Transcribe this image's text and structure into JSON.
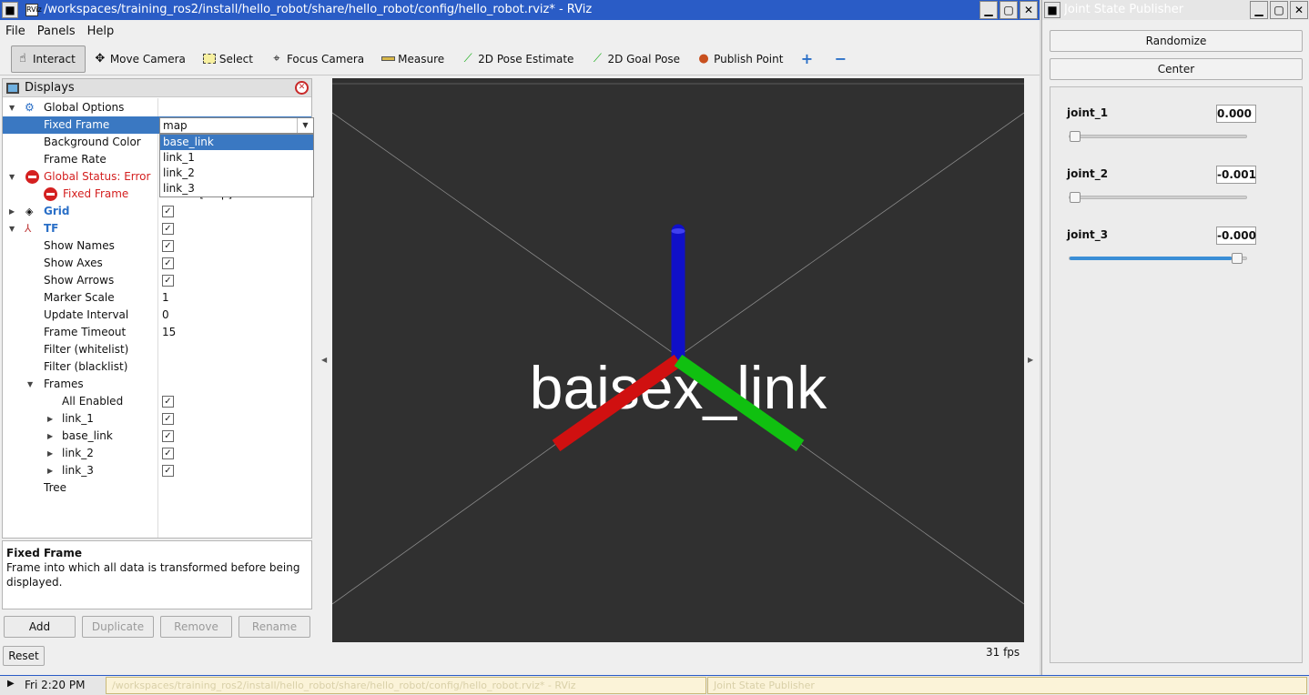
{
  "rviz": {
    "title": "/workspaces/training_ros2/install/hello_robot/share/hello_robot/config/hello_robot.rviz* - RViz",
    "app_icon": "RViz",
    "menus": [
      "File",
      "Panels",
      "Help"
    ],
    "tools": {
      "interact": "Interact",
      "move_camera": "Move Camera",
      "select": "Select",
      "focus_camera": "Focus Camera",
      "measure": "Measure",
      "pose_estimate": "2D Pose Estimate",
      "goal_pose": "2D Goal Pose",
      "publish_point": "Publish Point"
    },
    "displays": {
      "title": "Displays",
      "rows": {
        "global_options": "Global Options",
        "fixed_frame": "Fixed Frame",
        "fixed_frame_value": "map",
        "background_color": "Background Color",
        "frame_rate": "Frame Rate",
        "global_status": "Global Status: Error",
        "status_fixed_frame": "Fixed Frame",
        "status_fixed_frame_msg": "Frame [map] does not exist",
        "grid": "Grid",
        "tf": "TF",
        "show_names": "Show Names",
        "show_axes": "Show Axes",
        "show_arrows": "Show Arrows",
        "marker_scale": "Marker Scale",
        "marker_scale_value": "1",
        "update_interval": "Update Interval",
        "update_interval_value": "0",
        "frame_timeout": "Frame Timeout",
        "frame_timeout_value": "15",
        "filter_whitelist": "Filter (whitelist)",
        "filter_blacklist": "Filter (blacklist)",
        "frames": "Frames",
        "all_enabled": "All Enabled",
        "link_1": "link_1",
        "base_link": "base_link",
        "link_2": "link_2",
        "link_3": "link_3",
        "tree": "Tree"
      },
      "dropdown_options": [
        "base_link",
        "link_1",
        "link_2",
        "link_3"
      ]
    },
    "description": {
      "title": "Fixed Frame",
      "text": "Frame into which all data is transformed before being displayed."
    },
    "buttons": {
      "add": "Add",
      "duplicate": "Duplicate",
      "remove": "Remove",
      "rename": "Rename",
      "reset": "Reset"
    },
    "view": {
      "overlay_text": "baisex_link",
      "fps": "31 fps"
    },
    "colors": {
      "x_axis": "#d01010",
      "y_axis": "#10c010",
      "z_axis": "#1010c8",
      "view_bg": "#303030",
      "selection": "#3a78c2"
    }
  },
  "jsp": {
    "title": "Joint State Publisher",
    "randomize": "Randomize",
    "center": "Center",
    "joints": [
      {
        "name": "joint_1",
        "value": "0.000",
        "level": 0.0
      },
      {
        "name": "joint_2",
        "value": "-0.001",
        "level": 0.0
      },
      {
        "name": "joint_3",
        "value": "-0.000",
        "level": 0.97
      }
    ]
  },
  "taskbar": {
    "clock": "Fri 2:20 PM",
    "task1": "/workspaces/training_ros2/install/hello_robot/share/hello_robot/config/hello_robot.rviz* - RViz",
    "task2": "Joint State Publisher"
  }
}
